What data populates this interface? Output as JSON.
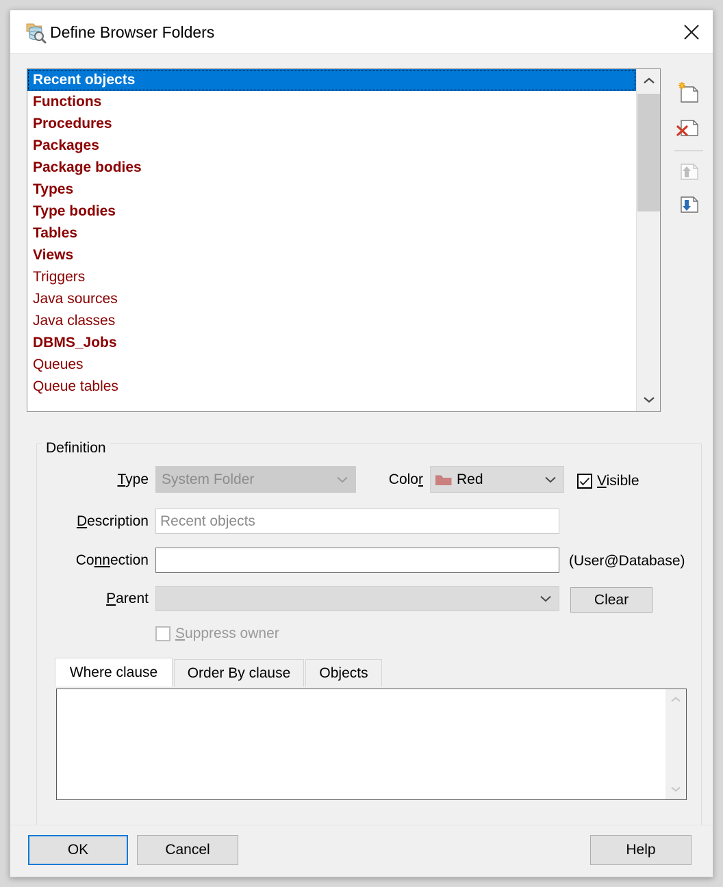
{
  "window": {
    "title": "Define Browser Folders",
    "icon": "folder-database-search-icon",
    "close_label": "×"
  },
  "folder_list": {
    "items": [
      {
        "label": "Recent objects",
        "bold": true,
        "selected": true
      },
      {
        "label": "Functions",
        "bold": true,
        "selected": false
      },
      {
        "label": "Procedures",
        "bold": true,
        "selected": false
      },
      {
        "label": "Packages",
        "bold": true,
        "selected": false
      },
      {
        "label": "Package bodies",
        "bold": true,
        "selected": false
      },
      {
        "label": "Types",
        "bold": true,
        "selected": false
      },
      {
        "label": "Type bodies",
        "bold": true,
        "selected": false
      },
      {
        "label": "Tables",
        "bold": true,
        "selected": false
      },
      {
        "label": "Views",
        "bold": true,
        "selected": false
      },
      {
        "label": "Triggers",
        "bold": false,
        "selected": false
      },
      {
        "label": "Java sources",
        "bold": false,
        "selected": false
      },
      {
        "label": "Java classes",
        "bold": false,
        "selected": false
      },
      {
        "label": "DBMS_Jobs",
        "bold": true,
        "selected": false
      },
      {
        "label": "Queues",
        "bold": false,
        "selected": false
      },
      {
        "label": "Queue tables",
        "bold": false,
        "selected": false
      }
    ],
    "item_color": "#8b0000",
    "selection_color": "#0078d7"
  },
  "toolbar": {
    "new_icon": "new-folder-icon",
    "delete_icon": "delete-folder-icon",
    "move_up_icon": "move-up-icon",
    "move_down_icon": "move-down-icon"
  },
  "definition": {
    "legend": "Definition",
    "type": {
      "label_pre": "",
      "label_mn": "T",
      "label_post": "ype",
      "value": "System Folder",
      "disabled": true
    },
    "color": {
      "label_pre": "Colo",
      "label_mn": "r",
      "label_post": "",
      "value": "Red",
      "swatch_color": "#cb8080"
    },
    "visible": {
      "label_pre": "",
      "label_mn": "V",
      "label_post": "isible",
      "checked": true
    },
    "description": {
      "label_pre": "",
      "label_mn": "D",
      "label_post": "escription",
      "value": "Recent objects"
    },
    "connection": {
      "label_pre": "Co",
      "label_mn": "nn",
      "label_post": "ection",
      "value": "",
      "hint": "(User@Database)"
    },
    "parent": {
      "label_pre": "",
      "label_mn": "P",
      "label_post": "arent",
      "value": "",
      "clear_label": "Clear"
    },
    "suppress_owner": {
      "label_pre": "",
      "label_mn": "S",
      "label_post": "uppress owner",
      "checked": false,
      "disabled": true
    }
  },
  "tabs": {
    "items": [
      {
        "label": "Where clause",
        "active": true
      },
      {
        "label": "Order By clause",
        "active": false
      },
      {
        "label": "Objects",
        "active": false
      }
    ],
    "clause_value": ""
  },
  "footer": {
    "ok_label": "OK",
    "cancel_label": "Cancel",
    "help_label": "Help",
    "focus_color": "#0078d7"
  }
}
